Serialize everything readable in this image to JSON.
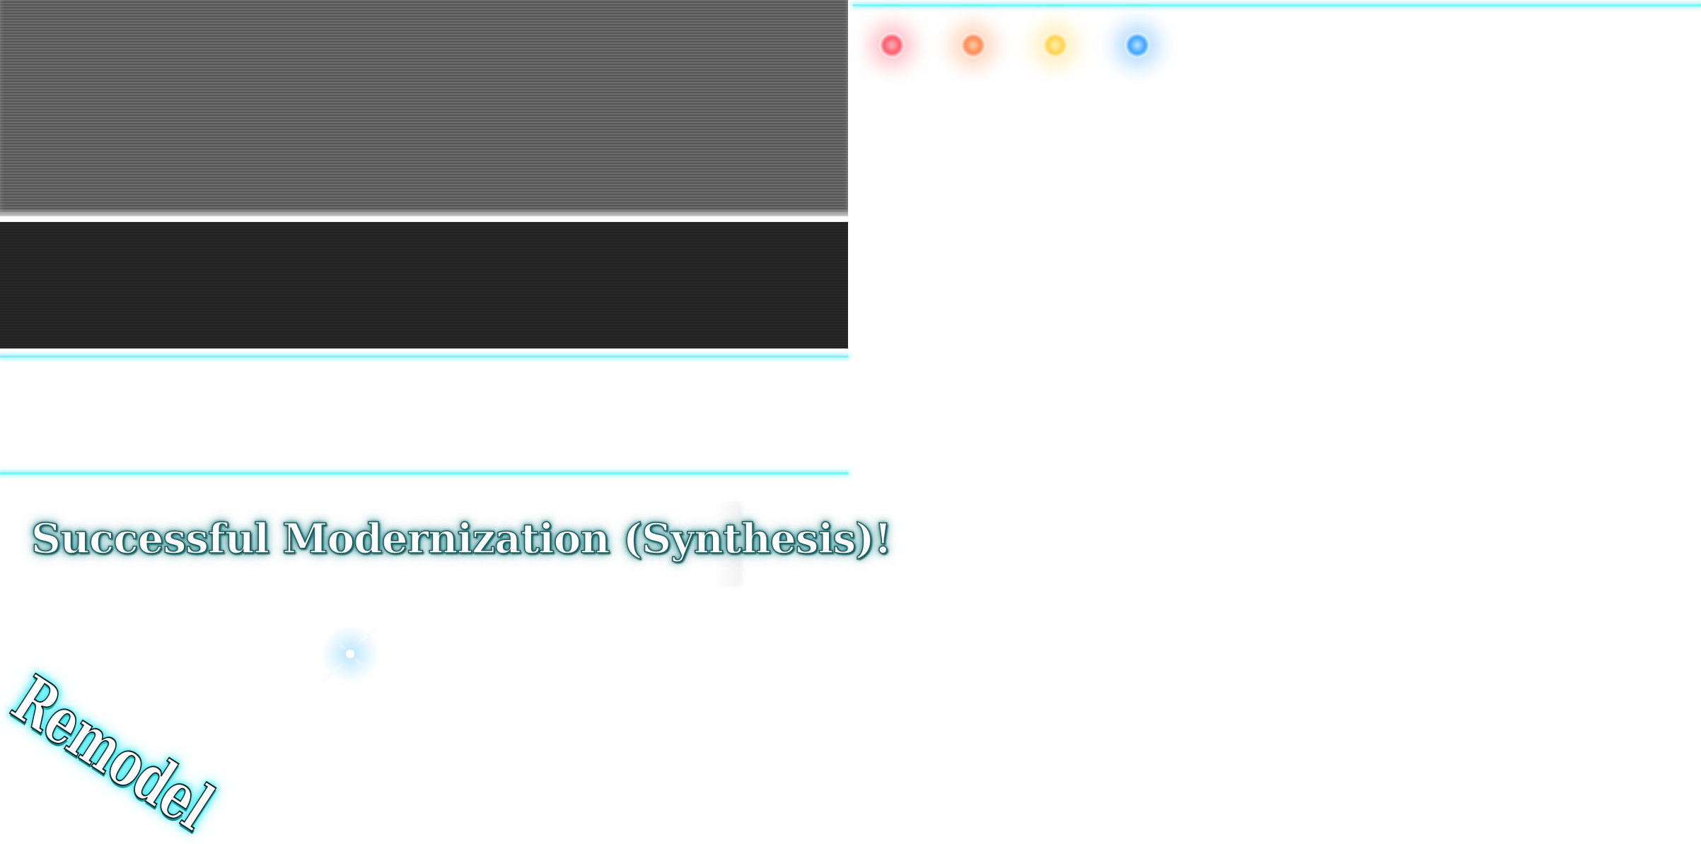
{
  "sprite_sheet": {
    "title_banner": {
      "text": "Successful Modernization (Synthesis)!"
    },
    "stamp": {
      "text": "Remodel"
    },
    "orbs": [
      {
        "name": "red-orb",
        "color": "#ff5d6e"
      },
      {
        "name": "orange-orb",
        "color": "#ff8d55"
      },
      {
        "name": "yellow-orb",
        "color": "#ffd34f"
      },
      {
        "name": "blue-orb",
        "color": "#3fa4ff"
      }
    ],
    "colors": {
      "accent_line": "#7ff3f5",
      "title_glow": "#1d5a5c",
      "stamp_glow": "#2af0f5",
      "panel_gray": "#6b6b6b",
      "panel_dark": "#2a2a2a"
    },
    "icons": {
      "sparkle": "sparkle-icon"
    }
  }
}
